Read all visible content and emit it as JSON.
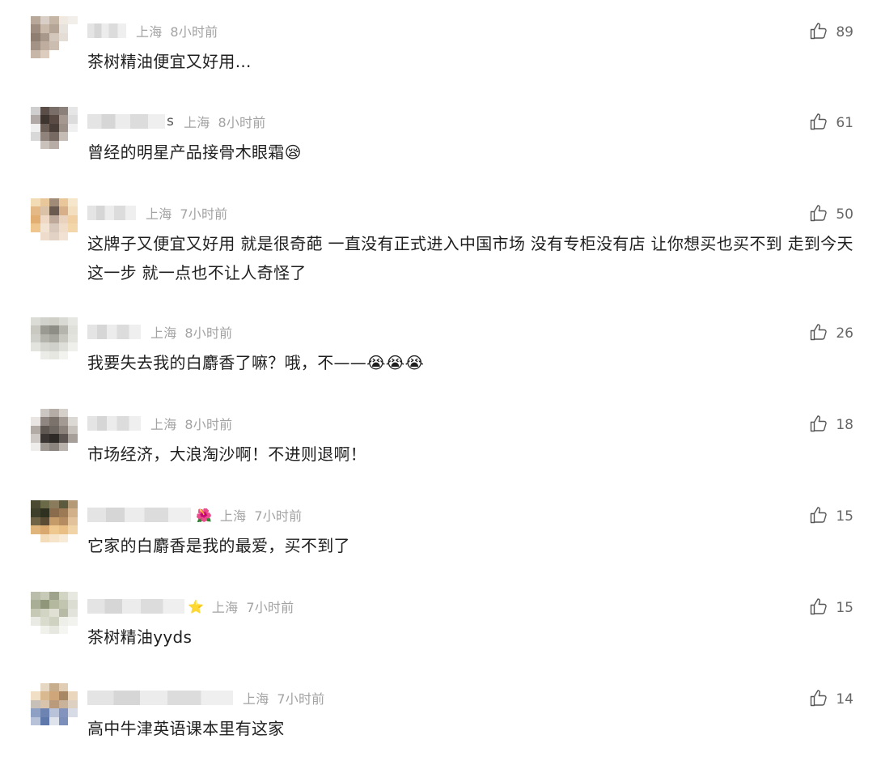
{
  "comments": [
    {
      "username_fragment": "",
      "location": "上海",
      "time": "8小时前",
      "text": "茶树精油便宜又好用...",
      "likes": "89",
      "avatar_colors": [
        "#b8a89a",
        "#d9cfc6",
        "#c4b5a5",
        "#efe9e2",
        "#f2eee9",
        "#9e8d80",
        "#c9b9aa",
        "#b5a597",
        "#e8e2dc",
        "#ffffff",
        "#8f7f73",
        "#a8988b",
        "#d3c6ba",
        "#e4ddd6",
        "#ffffff",
        "#a39386",
        "#bfae9f",
        "#cbbdb0",
        "#ffffff",
        "#ffffff",
        "#c6b7a8",
        "#dccdbf",
        "#ffffff",
        "#ffffff",
        "#ffffff"
      ]
    },
    {
      "username_fragment": "s",
      "location": "上海",
      "time": "8小时前",
      "text": "曾经的明星产品接骨木眼霜😪",
      "likes": "61",
      "avatar_colors": [
        "#cfcfcf",
        "#5b4e48",
        "#7a6e68",
        "#8c807a",
        "#e6e6e6",
        "#b0a9a5",
        "#3f3530",
        "#5a4c44",
        "#a59890",
        "#dcdcdc",
        "#efefef",
        "#6b5e57",
        "#4a3f38",
        "#9c8f88",
        "#f0f0f0",
        "#d8d8d8",
        "#8f837c",
        "#776a63",
        "#c6bcb6",
        "#ffffff",
        "#ffffff",
        "#c9c1bb",
        "#b7aca6",
        "#ffffff",
        "#ffffff"
      ]
    },
    {
      "username_fragment": "",
      "location": "上海",
      "time": "7小时前",
      "text": "这牌子又便宜又好用 就是很奇葩 一直没有正式进入中国市场 没有专柜没有店 让你想买也买不到 走到今天这一步 就一点也不让人奇怪了",
      "likes": "50",
      "avatar_colors": [
        "#f2dcb5",
        "#e8c89a",
        "#a08a78",
        "#e9c79b",
        "#f5e6cc",
        "#e4b985",
        "#d9c2a8",
        "#6b5a50",
        "#d7b08a",
        "#f3dfc0",
        "#e2ae72",
        "#efd9c4",
        "#bda89a",
        "#e9d3be",
        "#f0cfa2",
        "#f0c68f",
        "#f3e3d3",
        "#d8c8bc",
        "#efdcc9",
        "#f4d6ab",
        "#ffffff",
        "#eddccb",
        "#e2d2c5",
        "#f1e2d3",
        "#ffffff"
      ]
    },
    {
      "username_fragment": "",
      "location": "上海",
      "time": "8小时前",
      "text": "我要失去我的白麝香了嘛？哦，不——😭😭😭",
      "likes": "26",
      "avatar_colors": [
        "#dcdcd6",
        "#d2d2cc",
        "#cfcfc8",
        "#dadad4",
        "#e6e6e2",
        "#c9c9c2",
        "#9a9a92",
        "#8e8e86",
        "#b5b5ae",
        "#e0e0da",
        "#d0d0ca",
        "#b4b4ad",
        "#a8a8a0",
        "#c7c7c0",
        "#e3e3de",
        "#e4e4df",
        "#d6d6d0",
        "#d1d1cb",
        "#dfdfda",
        "#efefec",
        "#ffffff",
        "#ebebe7",
        "#e7e7e2",
        "#f2f2ef",
        "#ffffff"
      ]
    },
    {
      "username_fragment": "",
      "location": "上海",
      "time": "8小时前",
      "text": "市场经济，大浪淘沙啊！不进则退啊！",
      "likes": "18",
      "avatar_colors": [
        "#ffffff",
        "#cbc6c2",
        "#b5aca6",
        "#d6d0cb",
        "#ffffff",
        "#e8e5e2",
        "#8f8681",
        "#7c726c",
        "#a39a94",
        "#dcd8d4",
        "#b1aaa5",
        "#5f5751",
        "#6e6661",
        "#8b827c",
        "#c7c1bc",
        "#cfc9c5",
        "#3b3633",
        "#2e2a28",
        "#5b5450",
        "#a59e99",
        "#efedeb",
        "#9d9691",
        "#8a837e",
        "#b8b1ac",
        "#ffffff"
      ]
    },
    {
      "username_fragment": "",
      "location": "上海",
      "time": "7小时前",
      "text": "它家的白麝香是我的最爱，买不到了",
      "likes": "15",
      "avatar_colors": [
        "#4a4a32",
        "#6b6a48",
        "#8a7b5c",
        "#5c5a3e",
        "#b49a76",
        "#3e402b",
        "#2f3120",
        "#8a6c4d",
        "#9c7a55",
        "#d1b08a",
        "#6f6446",
        "#5a4b34",
        "#c59b6a",
        "#b58b62",
        "#e2c29a",
        "#e0b57c",
        "#d8a86e",
        "#eec88f",
        "#e9bf86",
        "#f1d3a8",
        "#ffffff",
        "#f3dcba",
        "#f5e4c9",
        "#f7ead6",
        "#ffffff"
      ]
    },
    {
      "username_fragment": "",
      "location": "上海",
      "time": "7小时前",
      "text": "茶树精油yyds",
      "likes": "15",
      "avatar_colors": [
        "#b9bda9",
        "#c7cab7",
        "#9ea38c",
        "#d2d4c4",
        "#e7e8df",
        "#a9ae96",
        "#8f9679",
        "#b4b89f",
        "#c2c6b0",
        "#dcddd2",
        "#c6c9b6",
        "#d3d5c4",
        "#e0e1d4",
        "#b7bba5",
        "#e2e3da",
        "#e9eae3",
        "#d9dbcd",
        "#cfd2c0",
        "#eeefe9",
        "#f2f3ee",
        "#ffffff",
        "#f0f1eb",
        "#e6e7de",
        "#f5f6f2",
        "#ffffff"
      ]
    },
    {
      "username_fragment": "",
      "location": "上海",
      "time": "7小时前",
      "text": "高中牛津英语课本里有这家",
      "likes": "14",
      "avatar_colors": [
        "#ffffff",
        "#e6d7c2",
        "#c8ad8c",
        "#e1cdb3",
        "#ffffff",
        "#f0dfc4",
        "#d9b98f",
        "#cfa57a",
        "#a88765",
        "#e9d6bd",
        "#c7c0b8",
        "#d8c4ac",
        "#b99b7c",
        "#c9b29a",
        "#ded0c0",
        "#8ea0c4",
        "#6d84b3",
        "#b8c2d8",
        "#8293bd",
        "#d6dbe6",
        "#b7c2d8",
        "#5f78ab",
        "#dfe3ec",
        "#7c8fba",
        "#ffffff"
      ]
    }
  ],
  "colors": {
    "text": "#1f1f1f",
    "meta": "#a3a3a3",
    "like": "#666666"
  },
  "icons": {
    "like": "thumbs-up-icon"
  }
}
